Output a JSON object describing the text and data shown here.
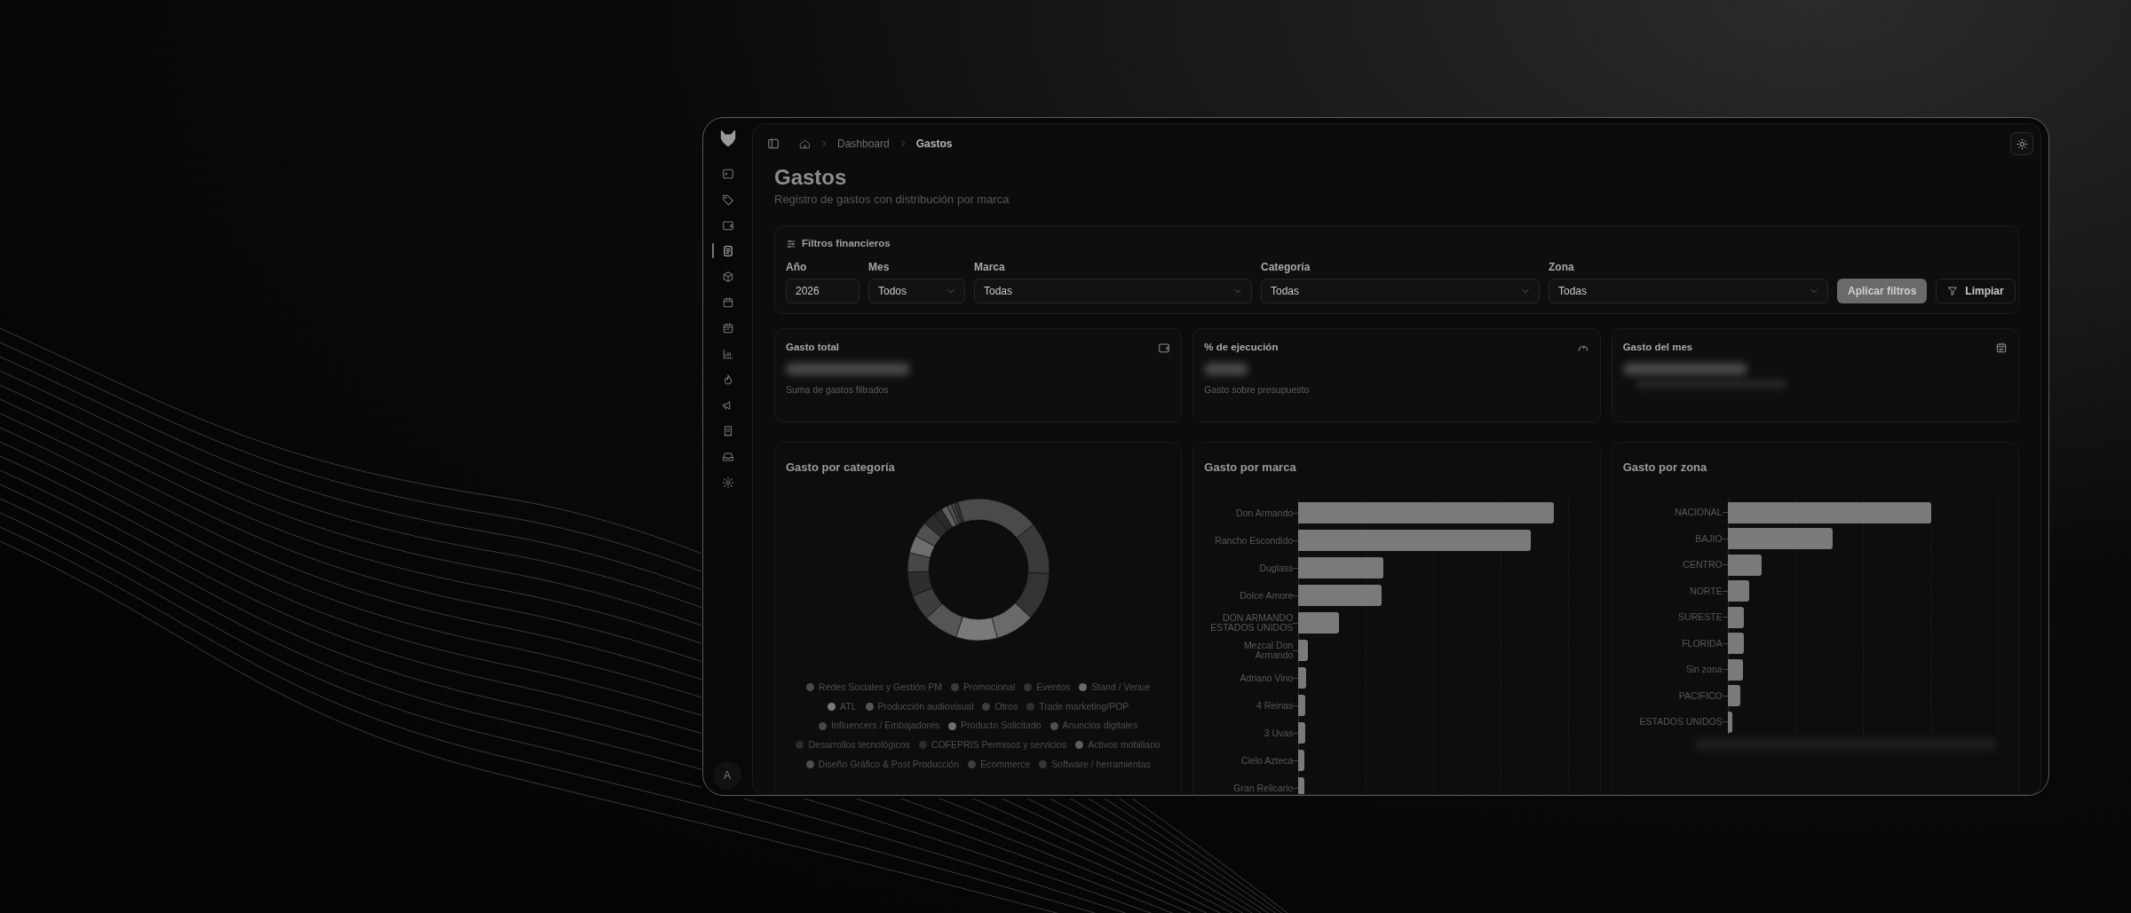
{
  "sidebar": {
    "nav_items": [
      {
        "selected": false
      },
      {
        "selected": false
      },
      {
        "selected": false
      },
      {
        "selected": true
      },
      {
        "selected": false
      },
      {
        "selected": false
      },
      {
        "selected": false
      },
      {
        "selected": false
      },
      {
        "selected": false
      },
      {
        "selected": false
      },
      {
        "selected": false
      },
      {
        "selected": false
      },
      {
        "selected": false
      }
    ],
    "avatar": "A"
  },
  "breadcrumb": [
    "Dashboard",
    "Gastos"
  ],
  "title": "Gastos",
  "subtitle": "Registro de gastos con distribución por marca",
  "filters": {
    "title": "Filtros financieros",
    "fields": [
      {
        "label": "Año",
        "value": "2026",
        "kind": "input"
      },
      {
        "label": "Mes",
        "value": "Todos",
        "kind": "select"
      },
      {
        "label": "Marca",
        "value": "Todas",
        "kind": "select"
      },
      {
        "label": "Categoría",
        "value": "Todas",
        "kind": "select"
      },
      {
        "label": "Zona",
        "value": "Todas",
        "kind": "select"
      }
    ],
    "buttons": [
      {
        "label": "Aplicar filtros",
        "kind": "primary"
      },
      {
        "label": "Limpiar",
        "kind": "secondary"
      }
    ]
  },
  "kpis": [
    {
      "title": "Gasto total",
      "caption": "Suma de gastos filtrados"
    },
    {
      "title": "% de ejecución",
      "caption": "Gasto sobre presupuesto"
    },
    {
      "title": "Gasto del mes"
    }
  ],
  "category_chart": {
    "title": "Gasto por categoría",
    "legend": [
      {
        "label": "Redes Sociales y Gestión PM",
        "color": "#4a4a4a"
      },
      {
        "label": "Promocional",
        "color": "#3a3a3a"
      },
      {
        "label": "Eventos",
        "color": "#333333"
      },
      {
        "label": "Stand / Venue",
        "color": "#6a6a6a"
      },
      {
        "label": "ATL",
        "color": "#7a7a7a"
      },
      {
        "label": "Producción audiovisual",
        "color": "#555555"
      },
      {
        "label": "Otros",
        "color": "#3d3d3d"
      },
      {
        "label": "Trade marketing/POP",
        "color": "#2e2e2e"
      },
      {
        "label": "Influencers / Embajadores",
        "color": "#474747"
      },
      {
        "label": "Producto Solicitado",
        "color": "#6e6e6e"
      },
      {
        "label": "Anuncios digitales",
        "color": "#505050"
      },
      {
        "label": "Desarrollos tecnológicos",
        "color": "#2c2c2c"
      },
      {
        "label": "COFEPRIS Permisos y servicios",
        "color": "#2a2a2a"
      },
      {
        "label": "Activos mobiliario",
        "color": "#5e5e5e"
      },
      {
        "label": "Diseño Gráfico & Post Producción",
        "color": "#4e4e4e"
      },
      {
        "label": "Ecommerce",
        "color": "#3f3f3f"
      },
      {
        "label": "Software / herramientas",
        "color": "#363636"
      }
    ]
  },
  "brand_chart": {
    "title": "Gasto por marca",
    "labels": [
      "Don Armando",
      "Rancho Escondido",
      "Duglass",
      "Dolce Amore",
      "DON ARMANDO ESTADOS UNIDOS",
      "Mezcal Don Armando",
      "Adriano Vino",
      "4 Reinas",
      "3 Uvas",
      "Cielo Azteca",
      "Gran Relicario"
    ]
  },
  "zone_chart": {
    "title": "Gasto por zona",
    "labels": [
      "NACIONAL",
      "BAJIO",
      "CENTRO",
      "NORTE",
      "SURESTE",
      "FLORIDA",
      "Sin zona",
      "PACIFICO",
      "ESTADOS UNIDOS"
    ]
  }
}
